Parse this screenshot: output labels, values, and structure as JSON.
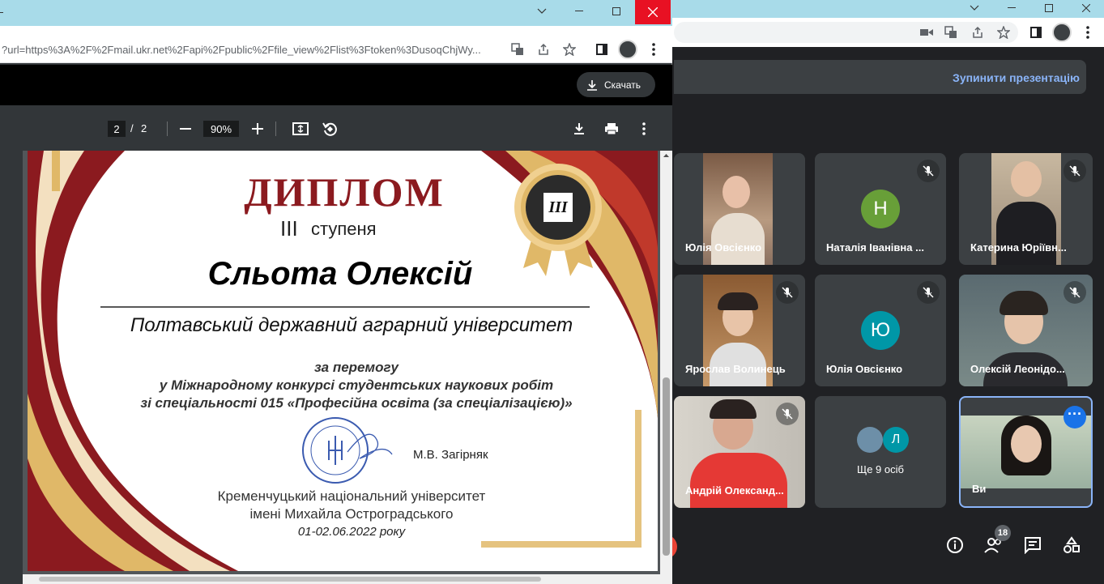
{
  "meet": {
    "stop_presentation": "Зупинити презентацію",
    "participants_count": "18",
    "tiles": [
      {
        "name": "Юлія Овсієнко",
        "type": "video",
        "muted": false
      },
      {
        "name": "Наталія Іванівна ...",
        "type": "letter",
        "letter": "Н",
        "color": "#689f38",
        "muted": true
      },
      {
        "name": "Катерина Юріївн...",
        "type": "video",
        "muted": true
      },
      {
        "name": "Ярослав Волинець",
        "type": "video",
        "muted": true
      },
      {
        "name": "Юлія Овсієнко",
        "type": "letter",
        "letter": "Ю",
        "color": "#0097a7",
        "muted": true
      },
      {
        "name": "Олексій Леонідо...",
        "type": "video",
        "muted": true
      },
      {
        "name": "Андрій Олександ...",
        "type": "video",
        "muted": true
      },
      {
        "name": "Ще 9 осіб",
        "type": "more",
        "letter": "Л"
      },
      {
        "name": "Ви",
        "type": "self"
      }
    ]
  },
  "popup": {
    "url": "?url=https%3A%2F%2Fmail.ukr.net%2Fapi%2Fpublic%2Ffile_view%2Flist%3Ftoken%3DusoqChjWy...",
    "download_label": "Скачать",
    "page_current": "2",
    "page_sep": "/",
    "page_total": "2",
    "zoom": "90%"
  },
  "diploma": {
    "title": "ДИПЛОМ",
    "degree_roman": "III",
    "degree_word": "ступеня",
    "medal_text": "III",
    "recipient": "Сльота Олексій",
    "university": "Полтавський державний аграрний університет",
    "line1": "за перемогу",
    "line2": "у Міжнародному конкурсі студентських наукових робіт",
    "line3": "зі спеціальності 015 «Професійна освіта (за спеціалізацією)»",
    "signatory": "М.В. Загірняк",
    "org1": "Кременчуцький національний університет",
    "org2": "імені Михайла Остроградського",
    "date": "01-02.06.2022 року"
  },
  "colors": {
    "accent_blue": "#8ab4f8",
    "diploma_red": "#8b1a1f",
    "gold": "#e0b868"
  }
}
